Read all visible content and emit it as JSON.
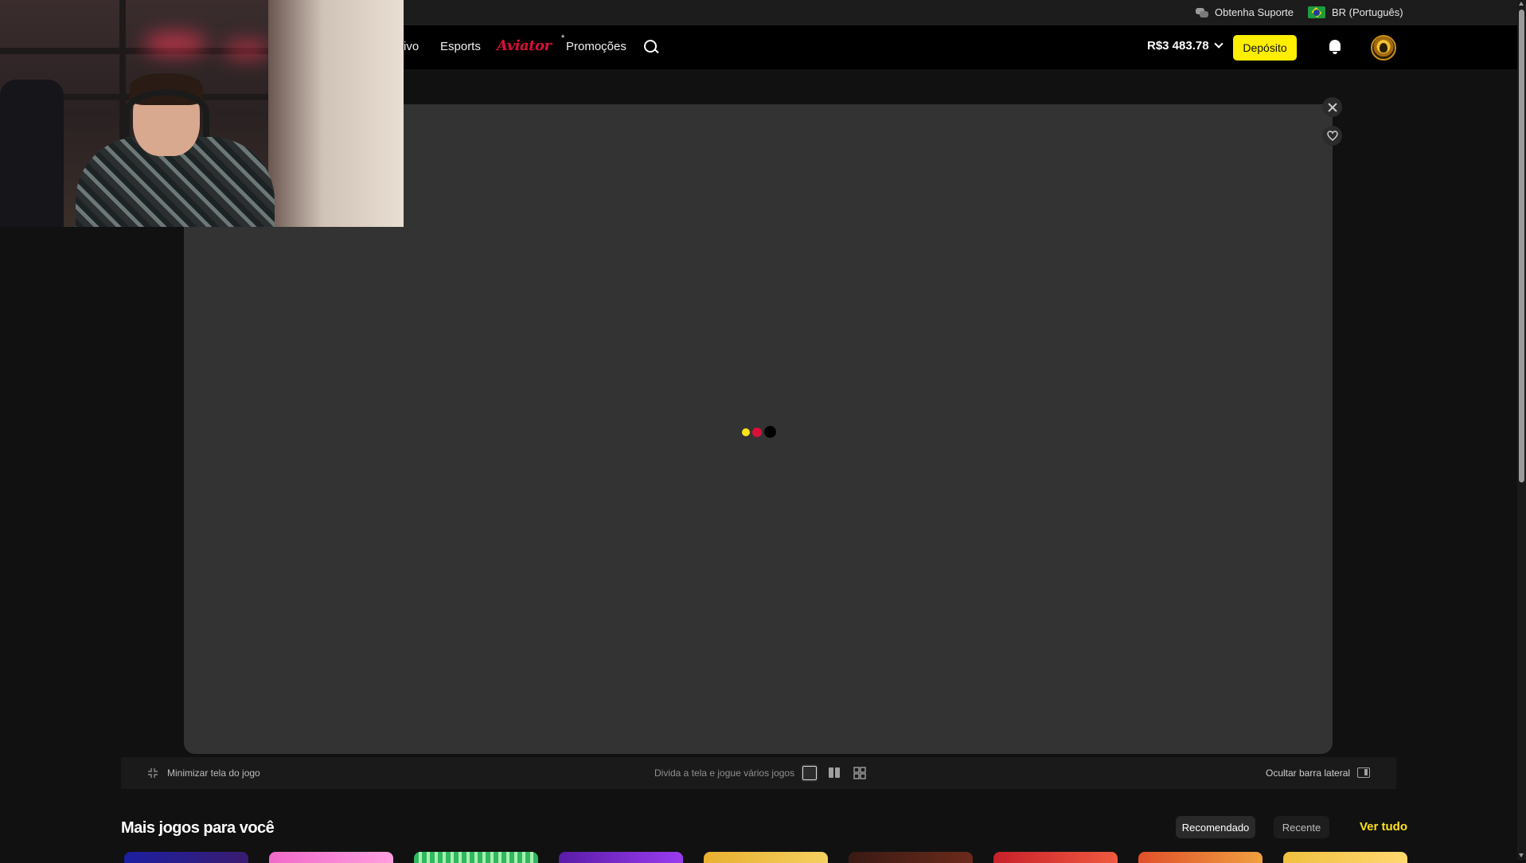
{
  "topbar": {
    "support_label": "Obtenha Suporte",
    "language_label": "BR (Português)"
  },
  "nav": {
    "items": [
      {
        "label": "ivo"
      },
      {
        "label": "Esports"
      },
      {
        "label": "Aviator"
      },
      {
        "label": "Promoções",
        "marker": "*"
      }
    ],
    "balance": "R$3 483.78",
    "deposit_label": "Depósito"
  },
  "game": {
    "loader_colors": [
      "#ffe11a",
      "#d8103a",
      "#000000"
    ]
  },
  "toolbar": {
    "minimize_label": "Minimizar tela do jogo",
    "split_label": "Divida a tela e jogue vários jogos",
    "hide_sidebar_label": "Ocultar barra lateral"
  },
  "more_games": {
    "title": "Mais jogos para você",
    "tabs": [
      {
        "label": "Recomendado",
        "active": true
      },
      {
        "label": "Recente",
        "active": false
      }
    ],
    "see_all_label": "Ver tudo"
  },
  "colors": {
    "accent": "#ffee00",
    "aviator_red": "#d8103a",
    "background": "#111111",
    "game_panel": "#333333"
  }
}
